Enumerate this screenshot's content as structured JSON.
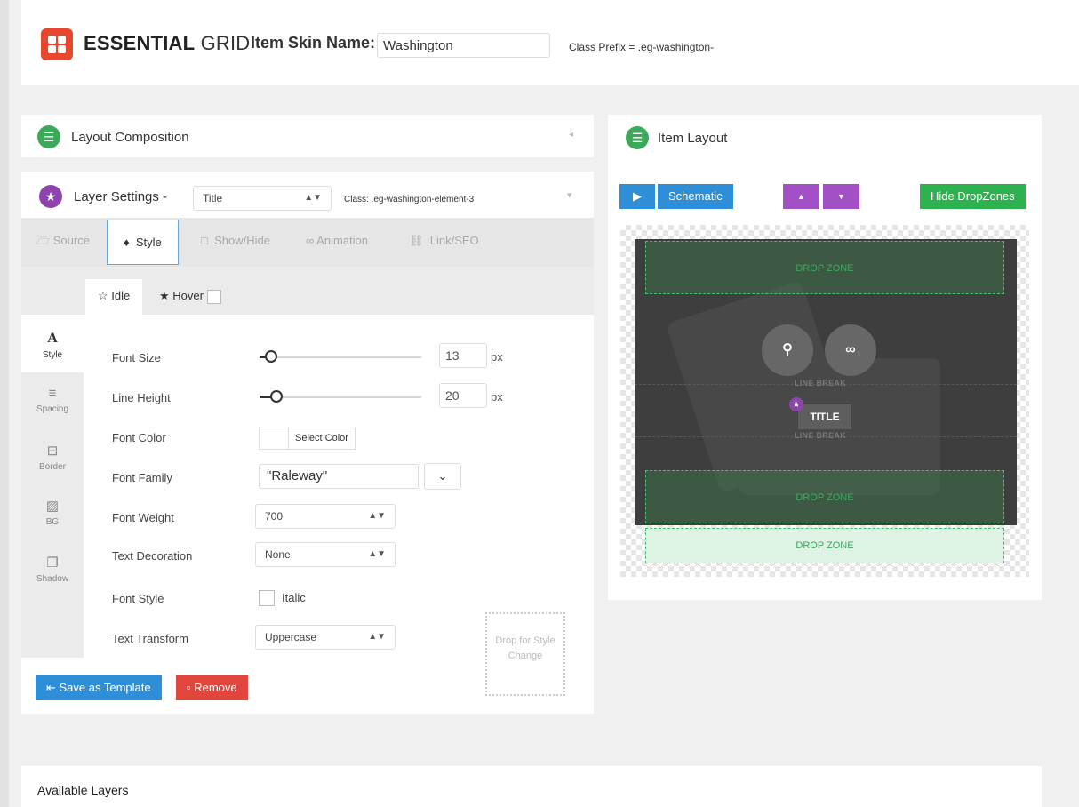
{
  "header": {
    "brand_bold": "ESSENTIAL",
    "brand_light": " GRID",
    "skin_name_label": "Item Skin Name:",
    "skin_name_value": "Washington",
    "class_prefix": "Class Prefix = .eg-washington-"
  },
  "layout_composition": {
    "title": "Layout Composition",
    "collapse_icon": "◂"
  },
  "layer_settings": {
    "title": "Layer Settings -",
    "layer_select": "Title",
    "class_label": "Class: .eg-washington-element-3",
    "collapse_icon": "▾",
    "tabs": [
      {
        "label": "Source",
        "icon": "folder-icon"
      },
      {
        "label": "Style",
        "icon": "drop-icon"
      },
      {
        "label": "Show/Hide",
        "icon": "square-icon"
      },
      {
        "label": "Animation",
        "icon": "chain-icon"
      },
      {
        "label": "Link/SEO",
        "icon": "link-icon"
      }
    ],
    "states": [
      {
        "label": "Idle",
        "icon": "star-outline-icon"
      },
      {
        "label": "Hover",
        "icon": "star-filled-icon"
      }
    ],
    "side_tabs": [
      {
        "label": "Style",
        "icon": "A"
      },
      {
        "label": "Spacing",
        "icon": "≡"
      },
      {
        "label": "Border",
        "icon": "⊟"
      },
      {
        "label": "BG",
        "icon": "▨"
      },
      {
        "label": "Shadow",
        "icon": "❐"
      }
    ],
    "fields": {
      "font_size": {
        "label": "Font Size",
        "value": "13",
        "unit": "px"
      },
      "line_height": {
        "label": "Line Height",
        "value": "20",
        "unit": "px"
      },
      "font_color": {
        "label": "Font Color",
        "button": "Select Color"
      },
      "font_family": {
        "label": "Font Family",
        "value": "\"Raleway\""
      },
      "font_weight": {
        "label": "Font Weight",
        "value": "700"
      },
      "text_decoration": {
        "label": "Text Decoration",
        "value": "None"
      },
      "font_style": {
        "label": "Font Style",
        "checkbox_label": "Italic"
      },
      "text_transform": {
        "label": "Text Transform",
        "value": "Uppercase"
      }
    },
    "drop_style": "Drop for Style Change",
    "save_template": "Save as Template",
    "remove": "Remove"
  },
  "item_layout": {
    "title": "Item Layout",
    "schematic": "Schematic",
    "hide_dropzones": "Hide DropZones",
    "drop_zone": "DROP ZONE",
    "line_break": "LINE BREAK",
    "title_chip": "TITLE"
  },
  "available_layers": {
    "title": "Available Layers"
  },
  "colors": {
    "accent_green": "#3aaa5a",
    "accent_purple": "#8e44ad",
    "accent_blue": "#2e8fd8",
    "danger_red": "#e0463b",
    "brand_red": "#e8472f"
  }
}
